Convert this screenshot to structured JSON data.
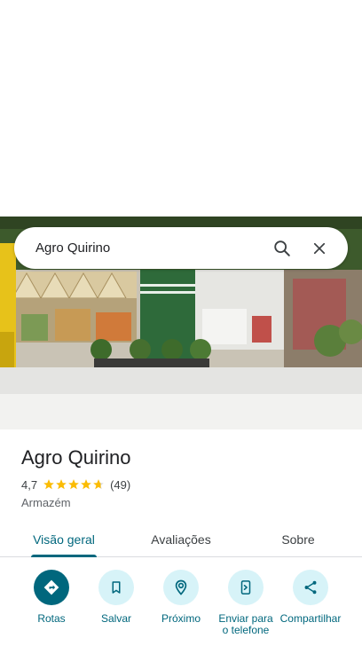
{
  "search": {
    "query": "Agro Quirino"
  },
  "icons": {
    "search": "search-icon",
    "close": "close-icon"
  },
  "place": {
    "name": "Agro Quirino",
    "rating": "4,7",
    "rating_stars": 4.7,
    "review_count": "(49)",
    "category": "Armazém"
  },
  "tabs": [
    {
      "label": "Visão geral",
      "active": true
    },
    {
      "label": "Avaliações",
      "active": false
    },
    {
      "label": "Sobre",
      "active": false
    }
  ],
  "actions": [
    {
      "label": "Rotas",
      "icon": "directions-icon"
    },
    {
      "label": "Salvar",
      "icon": "bookmark-icon"
    },
    {
      "label": "Próximo",
      "icon": "nearby-icon"
    },
    {
      "label": "Enviar para o telefone",
      "icon": "send-to-phone-icon"
    },
    {
      "label": "Compartilhar",
      "icon": "share-icon"
    }
  ],
  "colors": {
    "accent": "#00677d",
    "accent_light": "#d7f3f8",
    "star": "#fbbc04"
  }
}
